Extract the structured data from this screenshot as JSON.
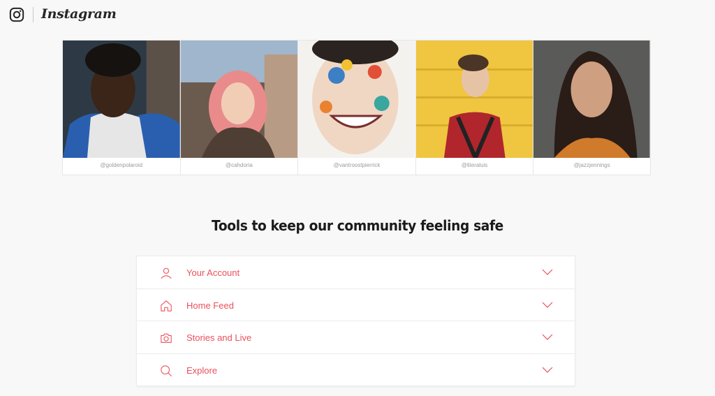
{
  "header": {
    "logo_icon": "instagram-glyph-icon",
    "wordmark": "Instagram"
  },
  "photos": [
    {
      "caption": "@goldenpolaroid"
    },
    {
      "caption": "@cahdoria"
    },
    {
      "caption": "@vantroostpierrick"
    },
    {
      "caption": "@literaluis"
    },
    {
      "caption": "@jazzjennings"
    }
  ],
  "section": {
    "title": "Tools to keep our community feeling safe"
  },
  "accordion": {
    "items": [
      {
        "label": "Your Account",
        "icon": "user-icon"
      },
      {
        "label": "Home Feed",
        "icon": "home-icon"
      },
      {
        "label": "Stories and Live",
        "icon": "camera-icon"
      },
      {
        "label": "Explore",
        "icon": "search-icon"
      }
    ]
  },
  "colors": {
    "accent": "#e8505b",
    "background": "#f8f8f8"
  }
}
